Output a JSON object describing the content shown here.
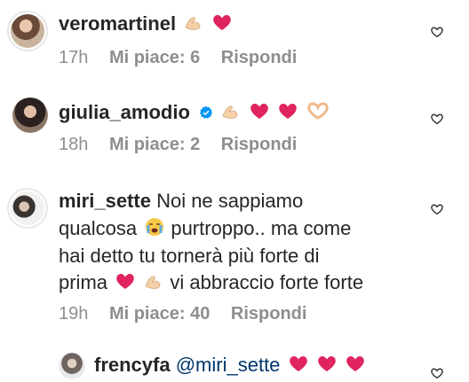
{
  "comments": [
    {
      "username": "veromartinel",
      "text": "",
      "emojis": [
        "flexed-biceps",
        "red-heart"
      ],
      "time": "17h",
      "likes": "Mi piace: 6",
      "reply": "Rispondi"
    },
    {
      "username": "giulia_amodio",
      "verified": true,
      "text": "",
      "emojis": [
        "flexed-biceps",
        "red-heart",
        "red-heart",
        "heart-hands"
      ],
      "time": "18h",
      "likes": "Mi piace: 2",
      "reply": "Rispondi"
    },
    {
      "username": "miri_sette",
      "lines": {
        "l1": "Noi ne sappiamo",
        "l2a": "qualcosa",
        "l2b": "purtroppo.. ma come",
        "l3": "hai detto tu tornerà più forte di",
        "l4a": "prima",
        "l4b": "vi abbraccio forte forte"
      },
      "emojis": [
        "crying-face",
        "red-heart",
        "flexed-biceps"
      ],
      "time": "19h",
      "likes": "Mi piace: 40",
      "reply": "Rispondi"
    },
    {
      "username": "frencyfa",
      "mention": "@miri_sette",
      "emojis": [
        "red-heart",
        "red-heart",
        "red-heart"
      ]
    }
  ],
  "colors": {
    "text": "#262626",
    "meta": "#8e8e8e",
    "mention": "#00376b",
    "verified": "#0095f6",
    "heart": "#e0245e"
  }
}
